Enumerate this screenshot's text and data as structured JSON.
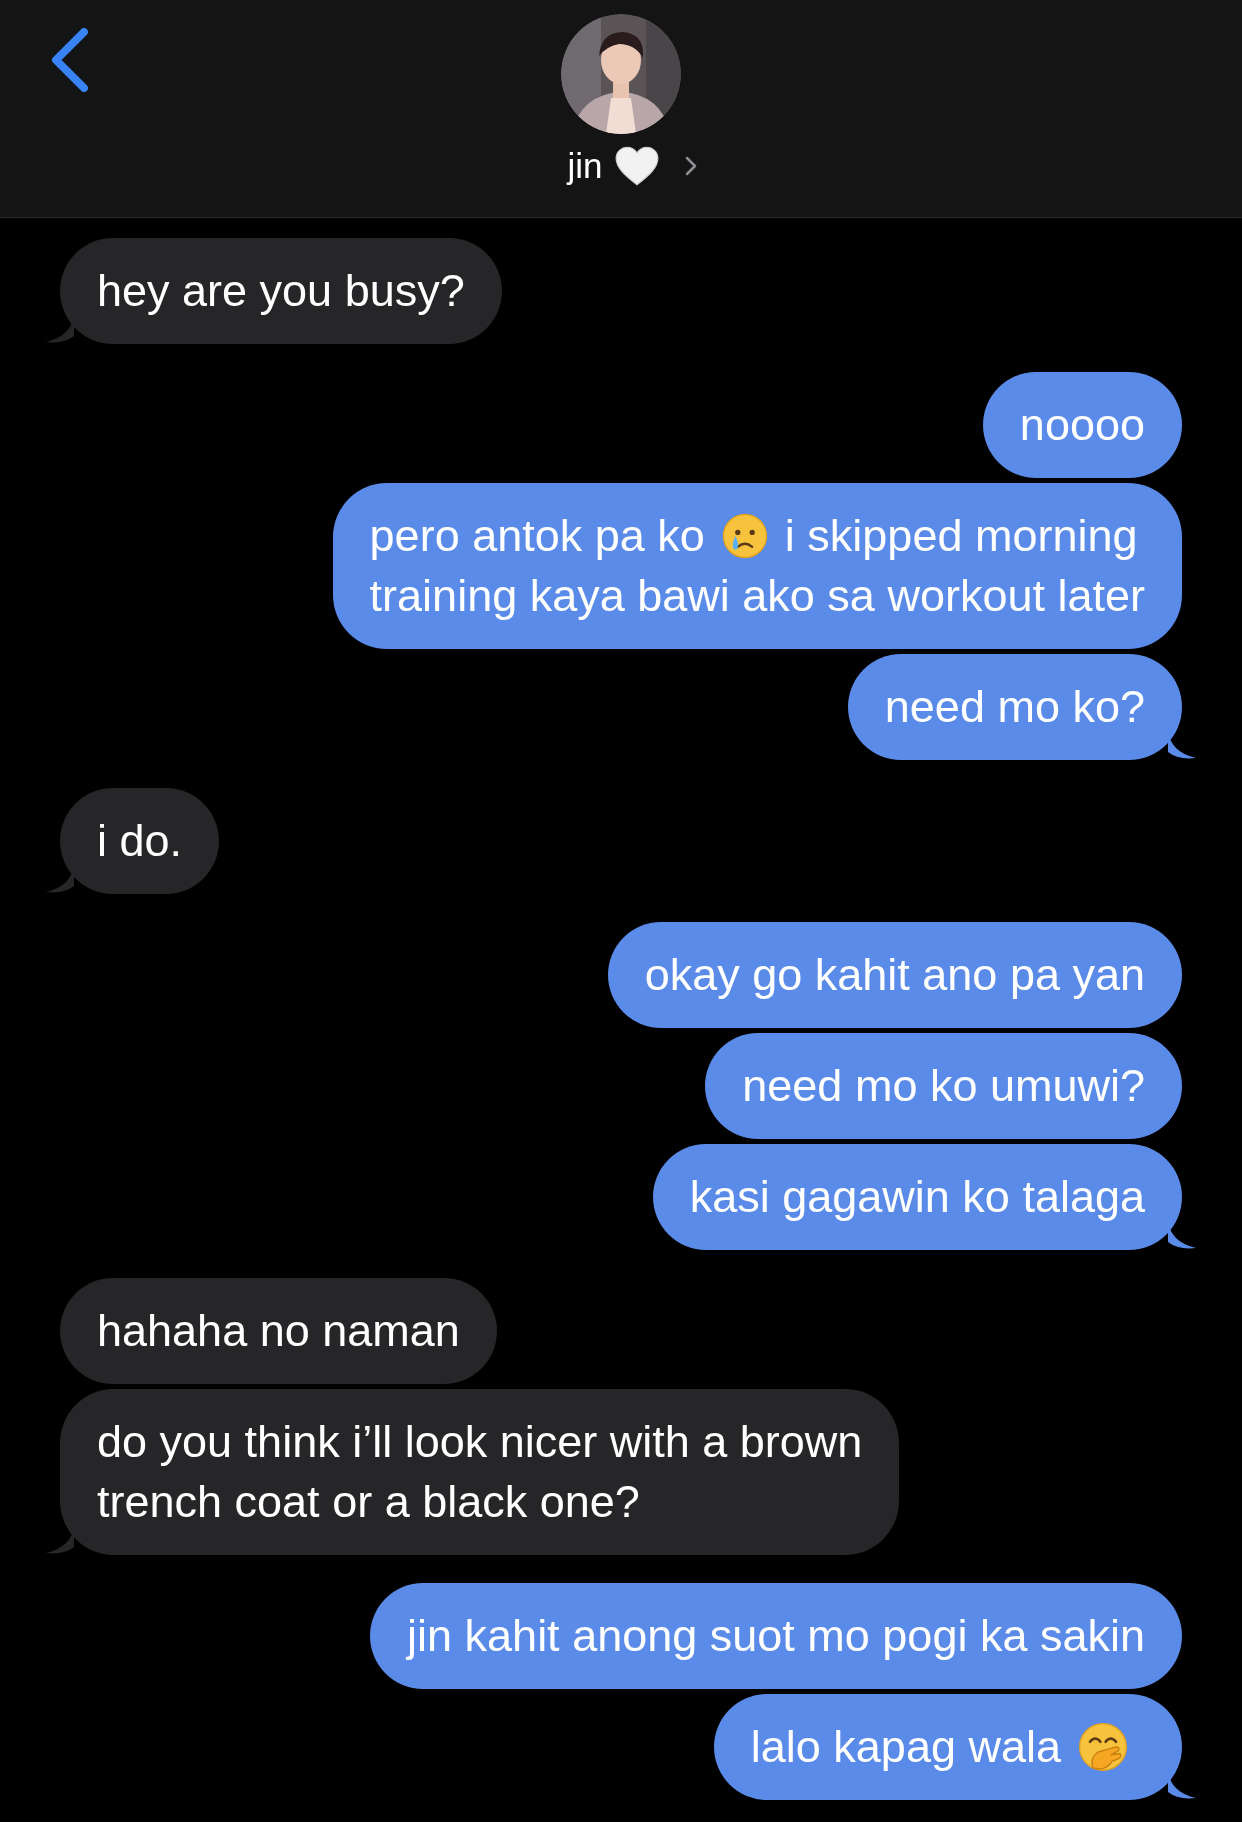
{
  "header": {
    "contact_name": "jin"
  },
  "messages": [
    {
      "kind": "received",
      "tail": true,
      "lines": [
        [
          {
            "kind": "text",
            "text": "hey are you busy?"
          }
        ]
      ]
    },
    {
      "kind": "sent",
      "tail": false,
      "lines": [
        [
          {
            "kind": "text",
            "text": "noooo"
          }
        ]
      ]
    },
    {
      "kind": "sent",
      "tail": false,
      "lines": [
        [
          {
            "kind": "text",
            "text": "pero antok pa ko"
          },
          {
            "kind": "crying-emoji"
          },
          {
            "kind": "text",
            "text": "i skipped morning"
          }
        ],
        [
          {
            "kind": "text",
            "text": "training kaya bawi ako sa workout later"
          }
        ]
      ]
    },
    {
      "kind": "sent",
      "tail": true,
      "lines": [
        [
          {
            "kind": "text",
            "text": "need mo ko?"
          }
        ]
      ]
    },
    {
      "kind": "received",
      "tail": true,
      "lines": [
        [
          {
            "kind": "text",
            "text": "i do."
          }
        ]
      ]
    },
    {
      "kind": "sent",
      "tail": false,
      "lines": [
        [
          {
            "kind": "text",
            "text": "okay go kahit ano pa yan"
          }
        ]
      ]
    },
    {
      "kind": "sent",
      "tail": false,
      "lines": [
        [
          {
            "kind": "text",
            "text": "need mo ko umuwi?"
          }
        ]
      ]
    },
    {
      "kind": "sent",
      "tail": true,
      "lines": [
        [
          {
            "kind": "text",
            "text": "kasi gagawin ko talaga"
          }
        ]
      ]
    },
    {
      "kind": "received",
      "tail": false,
      "lines": [
        [
          {
            "kind": "text",
            "text": "hahaha no naman"
          }
        ]
      ]
    },
    {
      "kind": "received",
      "tail": true,
      "lines": [
        [
          {
            "kind": "text",
            "text": "do you think i’ll look nicer with a brown"
          }
        ],
        [
          {
            "kind": "text",
            "text": "trench coat or a black one?"
          }
        ]
      ]
    },
    {
      "kind": "sent",
      "tail": false,
      "lines": [
        [
          {
            "kind": "text",
            "text": "jin kahit anong suot mo pogi ka sakin"
          }
        ]
      ]
    },
    {
      "kind": "sent",
      "tail": true,
      "lines": [
        [
          {
            "kind": "text",
            "text": "lalo kapag wala"
          },
          {
            "kind": "giggle-emoji"
          }
        ]
      ]
    }
  ]
}
